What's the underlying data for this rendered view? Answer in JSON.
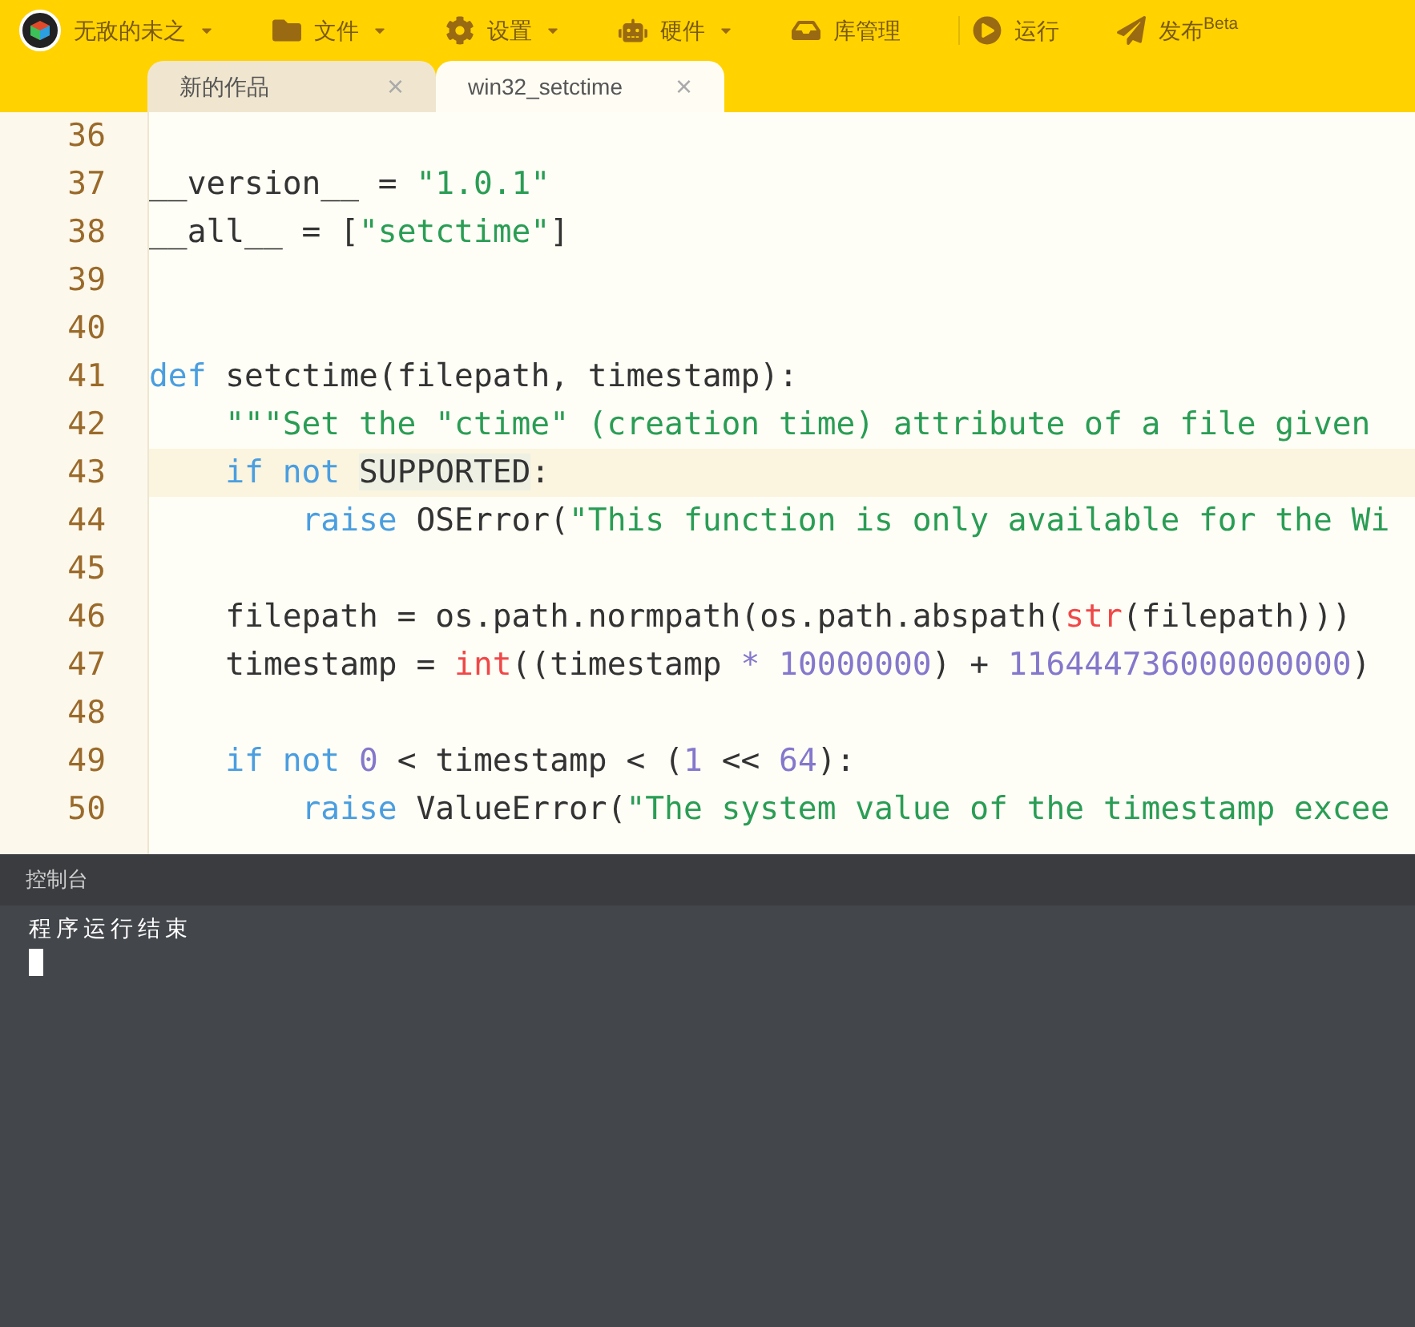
{
  "menu": [
    {
      "label": "无敌的未之",
      "dropdown": true
    },
    {
      "label": "文件",
      "dropdown": true
    },
    {
      "label": "设置",
      "dropdown": true
    },
    {
      "label": "硬件",
      "dropdown": true
    },
    {
      "label": "库管理",
      "dropdown": false
    },
    {
      "label": "运行",
      "dropdown": false
    },
    {
      "label": "发布$^{Beta}$",
      "dropdown": false
    }
  ],
  "tabs": [
    {
      "label": "新的作品",
      "close": "×",
      "selected": false
    },
    {
      "label": "win32_setctime",
      "close": "×",
      "selected": true
    }
  ],
  "editor": {
    "lines": [
      {
        "number": "36",
        "current": false
      },
      {
        "number": "37",
        "current": false,
        "tokens": [
          {
            "kind": "plain",
            "text": "__version__ = "
          },
          {
            "kind": "str",
            "text": "\"1.0.1\""
          }
        ]
      },
      {
        "number": "38",
        "current": false,
        "tokens": [
          {
            "kind": "plain",
            "text": "__all__ = ["
          },
          {
            "kind": "str",
            "text": "\"setctime\""
          },
          {
            "kind": "plain",
            "text": "]"
          }
        ]
      },
      {
        "number": "39",
        "current": false
      },
      {
        "number": "40",
        "current": false
      },
      {
        "number": "41",
        "current": false,
        "tokens": [
          {
            "kind": "kw",
            "text": "def"
          },
          {
            "kind": "plain",
            "text": " setctime(filepath, timestamp):"
          }
        ],
        "children": [
          {
            "number": "42",
            "current": false,
            "tokens": [
              {
                "kind": "str",
                "text": "\"\"\"Set the \"ctime\" (creation time) attribute of a file given"
              }
            ]
          },
          {
            "number": "43",
            "current": true,
            "tokens": [
              {
                "kind": "kw",
                "text": "if not "
              },
              {
                "kind": "match",
                "text": "SUPPORTED"
              },
              {
                "kind": "plain",
                "text": ":"
              }
            ],
            "children": [
              {
                "number": "44",
                "current": false,
                "tokens": [
                  {
                    "kind": "kw",
                    "text": "raise"
                  },
                  {
                    "kind": "plain",
                    "text": " OSError("
                  },
                  {
                    "kind": "str",
                    "text": "\"This function is only available for the Wi"
                  }
                ]
              }
            ]
          },
          {
            "number": "45",
            "current": false
          },
          {
            "number": "46",
            "current": false,
            "tokens": [
              {
                "kind": "plain",
                "text": "filepath = os.path.normpath(os.path.abspath("
              },
              {
                "kind": "builtin",
                "text": "str"
              },
              {
                "kind": "plain",
                "text": "(filepath)))"
              }
            ]
          },
          {
            "number": "47",
            "current": false,
            "tokens": [
              {
                "kind": "plain",
                "text": "timestamp = "
              },
              {
                "kind": "builtin",
                "text": "int"
              },
              {
                "kind": "plain",
                "text": "((timestamp "
              },
              {
                "kind": "op",
                "text": "* "
              },
              {
                "kind": "num",
                "text": "10000000"
              },
              {
                "kind": "plain",
                "text": ") + "
              },
              {
                "kind": "num",
                "text": "116444736000000000"
              },
              {
                "kind": "plain",
                "text": ")"
              }
            ]
          },
          {
            "number": "48",
            "current": false
          },
          {
            "number": "49",
            "current": false,
            "tokens": [
              {
                "kind": "kw",
                "text": "if not "
              },
              {
                "kind": "num",
                "text": "0"
              },
              {
                "kind": "plain",
                "text": " < timestamp < ("
              },
              {
                "kind": "num",
                "text": "1"
              },
              {
                "kind": "plain",
                "text": " << "
              },
              {
                "kind": "num",
                "text": "64"
              },
              {
                "kind": "plain",
                "text": "):"
              }
            ],
            "children": [
              {
                "number": "50",
                "current": false,
                "tokens": [
                  {
                    "kind": "kw",
                    "text": "raise"
                  },
                  {
                    "kind": "plain",
                    "text": " ValueError("
                  },
                  {
                    "kind": "str",
                    "text": "\"The system value of the timestamp excee"
                  }
                ]
              }
            ]
          }
        ]
      }
    ]
  },
  "console": {
    "title": "控制台",
    "output": "程序运行结束"
  }
}
